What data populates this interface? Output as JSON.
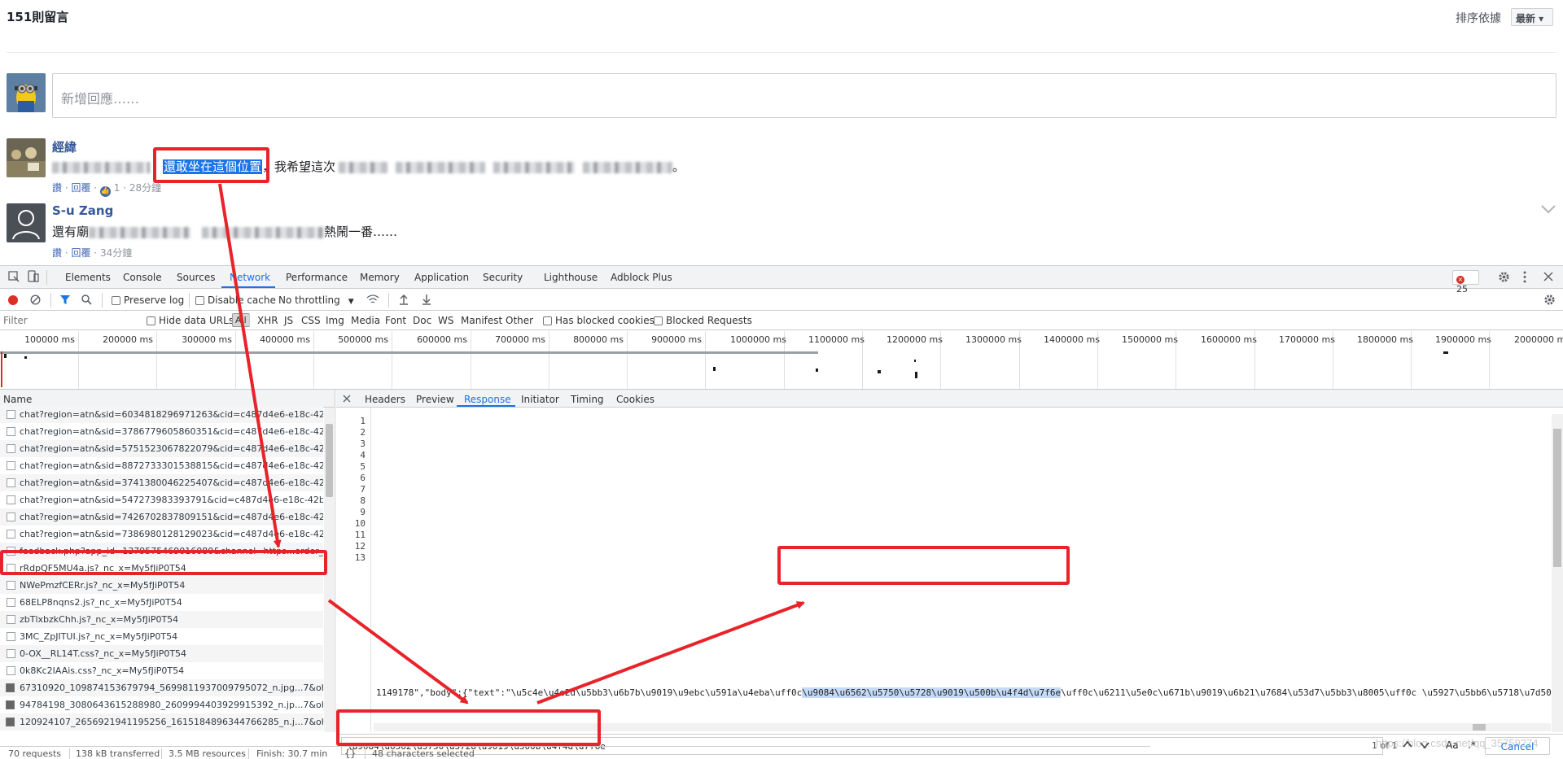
{
  "comments_header": {
    "count_title": "151則留言",
    "sort_label": "排序依據",
    "sort_value": "最新 ▾",
    "reply_placeholder": "新增回應……"
  },
  "comments": [
    {
      "author": "經緯",
      "text_highlight": "還敢坐在這個位置",
      "text_after_1": "，我希望這次",
      "text_end": "。",
      "like": "讚",
      "reply": "回覆",
      "reaction_count": "1",
      "time": "28分鐘"
    },
    {
      "author": "S-u Zang",
      "text_start": "還有廟",
      "text_end": "熱鬧一番……",
      "like": "讚",
      "reply": "回覆",
      "time": "34分鐘"
    }
  ],
  "devtools": {
    "main_tabs": [
      "Elements",
      "Console",
      "Sources",
      "Network",
      "Performance",
      "Memory",
      "Application",
      "Security",
      "Lighthouse",
      "Adblock Plus"
    ],
    "active_tab": "Network",
    "error_count": "25",
    "toolbar": {
      "preserve_log": "Preserve log",
      "disable_cache": "Disable cache",
      "throttling": "No throttling"
    },
    "filter": {
      "placeholder": "Filter",
      "hide_data_urls": "Hide data URLs",
      "all": "All",
      "types": [
        "XHR",
        "JS",
        "CSS",
        "Img",
        "Media",
        "Font",
        "Doc",
        "WS",
        "Manifest",
        "Other"
      ],
      "has_blocked_cookies": "Has blocked cookies",
      "blocked_requests": "Blocked Requests"
    },
    "timeline_labels": [
      "100000 ms",
      "200000 ms",
      "300000 ms",
      "400000 ms",
      "500000 ms",
      "600000 ms",
      "700000 ms",
      "800000 ms",
      "900000 ms",
      "1000000 ms",
      "1100000 ms",
      "1200000 ms",
      "1300000 ms",
      "1400000 ms",
      "1500000 ms",
      "1600000 ms",
      "1700000 ms",
      "1800000 ms",
      "1900000 ms",
      "2000000 ms"
    ],
    "name_header": "Name",
    "requests": [
      "chat?region=atn&sid=6034818296971263&cid=c487d4e6-e18c-42b0-",
      "chat?region=atn&sid=3786779605860351&cid=c487d4e6-e18c-42b0-",
      "chat?region=atn&sid=5751523067822079&cid=c487d4e6-e18c-42b0-",
      "chat?region=atn&sid=8872733301538815&cid=c487d4e6-e18c-42b0-",
      "chat?region=atn&sid=3741380046225407&cid=c487d4e6-e18c-42b0-",
      "chat?region=atn&sid=547273983393791&cid=c487d4e6-e18c-42b0-",
      "chat?region=atn&sid=7426702837809151&cid=c487d4e6-e18c-42b0-",
      "chat?region=atn&sid=7386980128129023&cid=c487d4e6-e18c-42b0-",
      "feedback.php?app_id=1379575469016080&channel=https...order_by=",
      "rRdpQF5MU4a.js?_nc_x=My5fJiP0T54",
      "NWePmzfCERr.js?_nc_x=My5fJiP0T54",
      "68ELP8nqns2.js?_nc_x=My5fJiP0T54",
      "zbTlxbzkChh.js?_nc_x=My5fJiP0T54",
      "3MC_ZpJITUI.js?_nc_x=My5fJiP0T54",
      "0-OX__RL14T.css?_nc_x=My5fJiP0T54",
      "0k8Kc2IAAis.css?_nc_x=My5fJiP0T54",
      "67310920_109874153679794_5699811937009795072_n.jpg...7&oh=87",
      "94784198_3080643615288980_2609994403929915392_n.jp...7&oh=87",
      "120924107_2656921941195256_1615184896344766285_n.j...7&oh=84"
    ],
    "detail_tabs": [
      "Headers",
      "Preview",
      "Response",
      "Initiator",
      "Timing",
      "Cookies"
    ],
    "active_detail_tab": "Response",
    "line_numbers": [
      "1",
      "2",
      "3",
      "4",
      "5",
      "6",
      "7",
      "8",
      "9",
      "10",
      "11",
      "12",
      "13"
    ],
    "response_line_prefix": "1149178\",\"body\":{\"text\":\"\\u5c4e\\u4e2d\\u5bb3\\u6b7b\\u9019\\u9ebc\\u591a\\u4eba\\u",
    "response_line_cut": "ff0c",
    "response_line_match": "\\u9084\\u6562\\u5750\\u5728\\u9019\\u500b\\u4f4d\\u7f6e",
    "response_line_suffix": "\\uff0c\\u6211\\u5e0c\\u671b\\u9019\\u6b21\\u7684\\u53d7\\u5bb3\\u8005\\uff0c \\u5927\\u5bb6\\u5718\\u7d50\\u",
    "search": {
      "value": "\\u9084\\u6562\\u5750\\u5728\\u9019\\u500b\\u4f4d\\u7f6e",
      "match_count": "1 of 1",
      "aa": "Aa",
      "regex": ".*",
      "cancel": "Cancel"
    },
    "status": {
      "requests": "70 requests",
      "transferred": "138 kB transferred",
      "resources": "3.5 MB resources",
      "finish": "Finish: 30.7 min",
      "braces": "{}",
      "selected": "48 characters selected"
    }
  },
  "watermark": "https://blog.csdn.net/qq_35759274",
  "colors": {
    "annotation_red": "#e8232a",
    "devtools_blue": "#1a73e8",
    "fb_link": "#365899"
  }
}
